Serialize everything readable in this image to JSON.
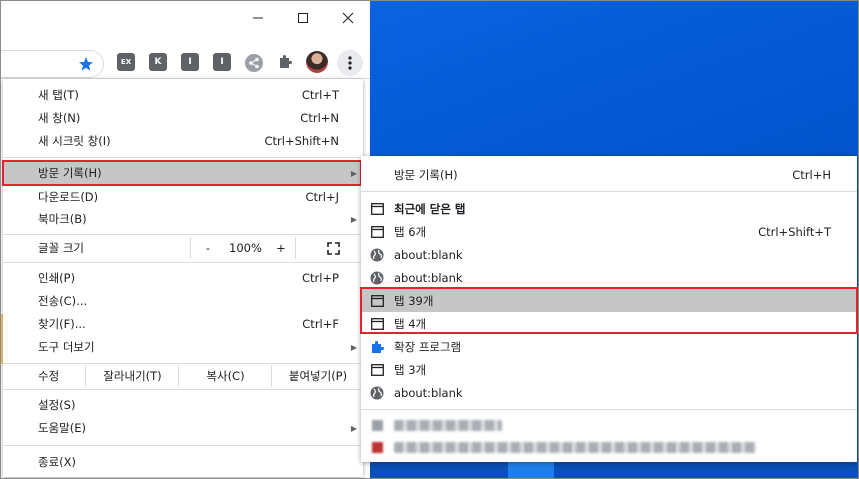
{
  "menu": {
    "items": [
      {
        "label": "새 탭(T)",
        "shortcut": "Ctrl+T"
      },
      {
        "label": "새 창(N)",
        "shortcut": "Ctrl+N"
      },
      {
        "label": "새 시크릿 창(I)",
        "shortcut": "Ctrl+Shift+N"
      },
      {
        "label": "방문 기록(H)",
        "shortcut": ""
      },
      {
        "label": "다운로드(D)",
        "shortcut": "Ctrl+J"
      },
      {
        "label": "북마크(B)",
        "shortcut": ""
      }
    ],
    "zoom": {
      "label": "글꼴 크기",
      "minus": "-",
      "value": "100%",
      "plus": "+"
    },
    "items2": [
      {
        "label": "인쇄(P)",
        "shortcut": "Ctrl+P"
      },
      {
        "label": "전송(C)...",
        "shortcut": ""
      },
      {
        "label": "찾기(F)...",
        "shortcut": "Ctrl+F"
      },
      {
        "label": "도구 더보기",
        "shortcut": ""
      }
    ],
    "edit": {
      "label": "수정",
      "cut": "잘라내기(T)",
      "copy": "복사(C)",
      "paste": "붙여넣기(P)"
    },
    "items3": [
      {
        "label": "설정(S)"
      },
      {
        "label": "도움말(E)"
      },
      {
        "label": "종료(X)"
      }
    ]
  },
  "history_submenu": {
    "header": {
      "label": "방문 기록(H)",
      "shortcut": "Ctrl+H"
    },
    "recently_closed_title": "최근에 닫은 탭",
    "entries": [
      {
        "label": "탭 6개",
        "shortcut": "Ctrl+Shift+T",
        "icon": "tab-icon"
      },
      {
        "label": "about:blank",
        "shortcut": "",
        "icon": "globe-icon"
      },
      {
        "label": "about:blank",
        "shortcut": "",
        "icon": "globe-icon"
      },
      {
        "label": "탭 39개",
        "shortcut": "",
        "icon": "tab-icon"
      },
      {
        "label": "탭 4개",
        "shortcut": "",
        "icon": "tab-icon"
      },
      {
        "label": "확장 프로그램",
        "shortcut": "",
        "icon": "puzzle-icon"
      },
      {
        "label": "탭 3개",
        "shortcut": "",
        "icon": "tab-icon"
      },
      {
        "label": "about:blank",
        "shortcut": "",
        "icon": "globe-icon"
      }
    ]
  },
  "toolbar": {
    "ext_labels": [
      "EX",
      "K",
      "I",
      "I"
    ]
  },
  "colors": {
    "highlight": "#c6c6c6",
    "red_box": "#e3232e",
    "desktop_blue": "#0a5bd3",
    "star": "#1a73e8"
  }
}
